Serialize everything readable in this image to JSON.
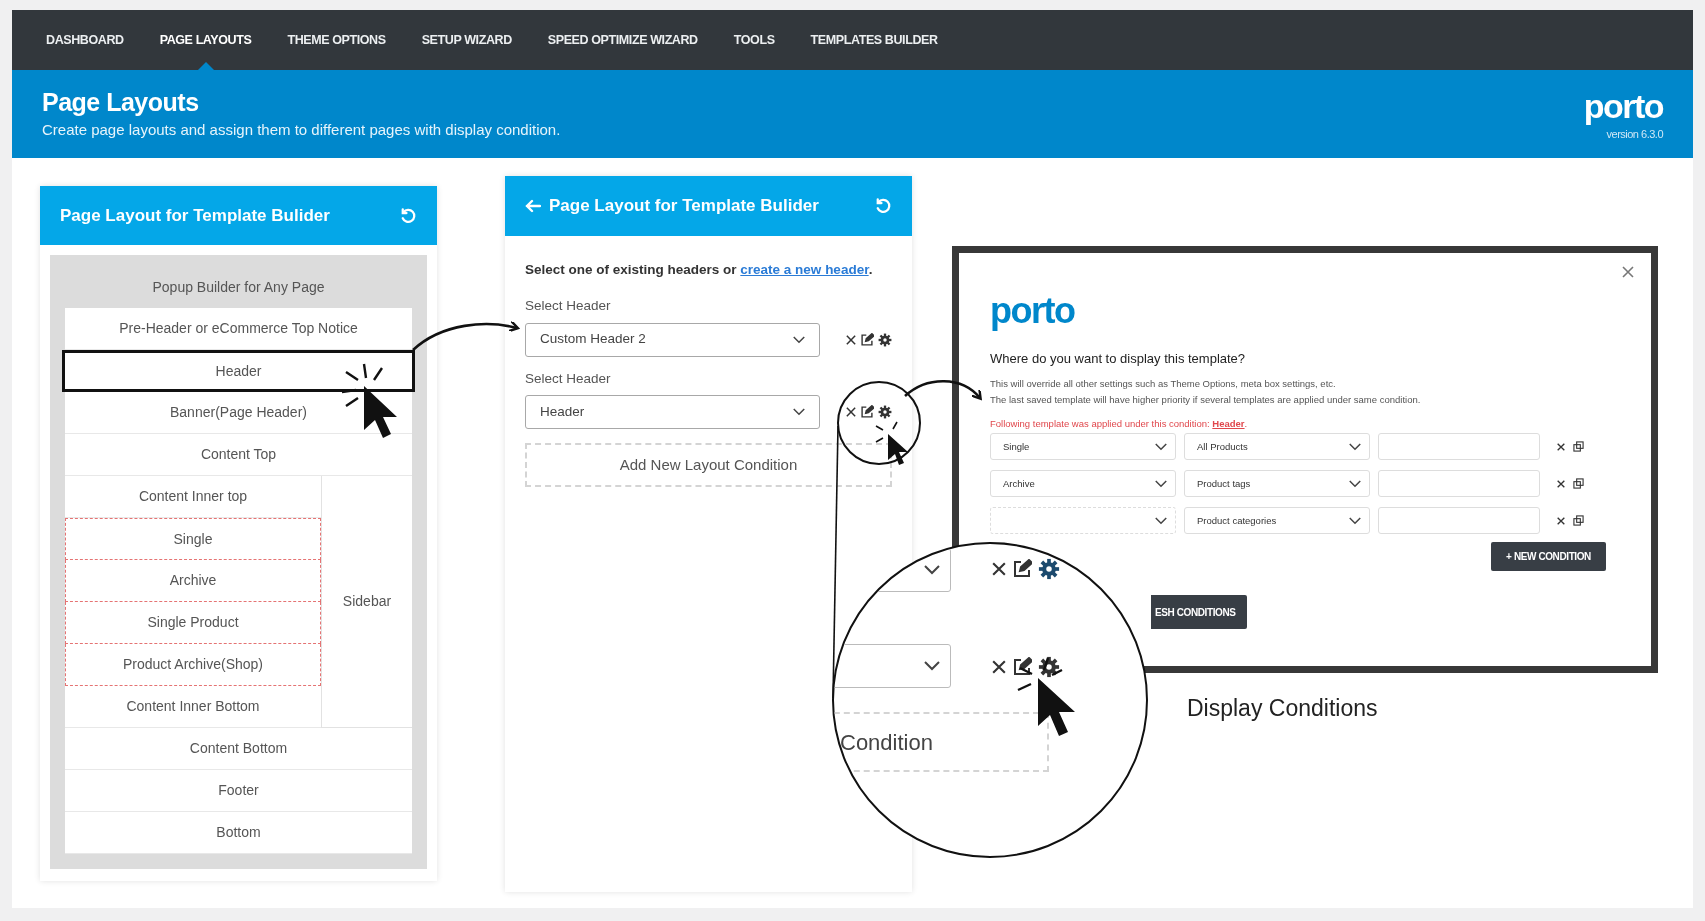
{
  "nav": {
    "items": [
      {
        "label": "DASHBOARD",
        "selected": false
      },
      {
        "label": "PAGE LAYOUTS",
        "selected": true
      },
      {
        "label": "THEME OPTIONS",
        "selected": false
      },
      {
        "label": "SETUP WIZARD",
        "selected": false
      },
      {
        "label": "SPEED OPTIMIZE WIZARD",
        "selected": false
      },
      {
        "label": "TOOLS",
        "selected": false
      },
      {
        "label": "TEMPLATES BUILDER",
        "selected": false
      }
    ]
  },
  "banner": {
    "title": "Page Layouts",
    "subtitle": "Create page layouts and assign them to different pages with display condition.",
    "logo": "porto",
    "version": "version 6.3.0"
  },
  "layout_panel": {
    "title": "Page Layout for Template Bulider",
    "top_rows": [
      {
        "label": "Popup Builder for Any Page",
        "selected": false,
        "kind": "bare"
      },
      {
        "label": "Pre-Header or eCommerce Top Notice",
        "selected": false,
        "kind": "row"
      },
      {
        "label": "Header",
        "selected": true,
        "kind": "row"
      },
      {
        "label": "Banner(Page Header)",
        "selected": false,
        "kind": "row"
      },
      {
        "label": "Content Top",
        "selected": false,
        "kind": "row"
      }
    ],
    "content_column": [
      {
        "label": "Content Inner top",
        "selected": false,
        "kind": "row"
      },
      {
        "label": "Single",
        "selected": false,
        "kind": "template"
      },
      {
        "label": "Archive",
        "selected": false,
        "kind": "template"
      },
      {
        "label": "Single Product",
        "selected": false,
        "kind": "template"
      },
      {
        "label": "Product Archive(Shop)",
        "selected": false,
        "kind": "template"
      },
      {
        "label": "Content Inner Bottom",
        "selected": false,
        "kind": "row"
      }
    ],
    "sidebar": {
      "label": "Sidebar",
      "selected": false
    },
    "bottom_rows": [
      {
        "label": "Content Bottom",
        "selected": false,
        "kind": "row"
      },
      {
        "label": "Footer",
        "selected": false,
        "kind": "row"
      },
      {
        "label": "Bottom",
        "selected": false,
        "kind": "row"
      }
    ]
  },
  "header_panel": {
    "title": "Page Layout for Template Bulider",
    "intro": "Select one of existing headers or ",
    "intro_link": "create a new header",
    "intro_end": ".",
    "fields": [
      {
        "label": "Select Header",
        "value": "Custom Header 2"
      },
      {
        "label": "Select Header",
        "value": "Header"
      }
    ],
    "add_button": "Add New Layout Condition"
  },
  "dialog": {
    "logo": "porto",
    "question": "Where do you want to display this template?",
    "notes": [
      "This will override all other settings such as Theme Options, meta box settings, etc.",
      "The last saved template will have higher priority if several templates are applied under same condition."
    ],
    "warning": "Following template was applied under this condition: ",
    "warning_link": "Header",
    "warning_end": ".",
    "conditions": [
      {
        "column_1": "Single",
        "column_2": "All Products"
      },
      {
        "column_1": "Archive",
        "column_2": "Product tags"
      },
      {
        "column_2": "Product categories"
      }
    ],
    "new_condition_button": "+ NEW CONDITION",
    "refresh_button": "ESH CONDITIONS"
  },
  "caption": "Display Conditions",
  "magnifier": {
    "button_text": "Condition"
  }
}
